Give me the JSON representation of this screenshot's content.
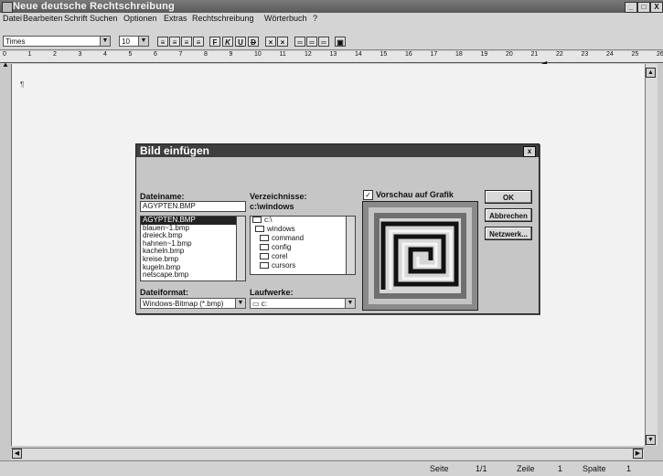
{
  "window": {
    "title": "Neue deutsche Rechtschreibung",
    "controls": [
      "_",
      "□",
      "X"
    ]
  },
  "menu": [
    "Datei",
    "Bearbeiten",
    "Schrift",
    "Suchen",
    "Optionen",
    "Extras",
    "Rechtschreibung",
    "Wörterbuch",
    "?"
  ],
  "toolbar": {
    "font_name": "Times",
    "font_size": "10",
    "format_buttons": [
      "F",
      "K",
      "U",
      "D"
    ]
  },
  "ruler": [
    "0",
    "1",
    "2",
    "3",
    "4",
    "5",
    "6",
    "7",
    "8",
    "9",
    "10",
    "11",
    "12",
    "13",
    "14",
    "15",
    "16",
    "17",
    "18",
    "19",
    "20",
    "21",
    "22",
    "23",
    "24",
    "25",
    "26"
  ],
  "dialog": {
    "title": "Bild einfügen",
    "close": "x",
    "filename_label": "Dateiname:",
    "filename_value": "AGYPTEN.BMP",
    "files": [
      "AGYPTEN.BMP",
      "blauen~1.bmp",
      "dreieck.bmp",
      "hahnen~1.bmp",
      "kacheln.bmp",
      "kreise.bmp",
      "kugeln.bmp",
      "netscape.bmp"
    ],
    "dir_label": "Verzeichnisse:",
    "dir_current": "c:\\windows",
    "dirs": [
      "c:\\",
      "windows",
      "command",
      "config",
      "corel",
      "cursors"
    ],
    "format_label": "Dateiformat:",
    "format_value": "Windows-Bitmap (*.bmp)",
    "drive_label": "Laufwerke:",
    "drive_value": "c:",
    "preview_label": "Vorschau auf Grafik",
    "preview_checked": "✓",
    "ok": "OK",
    "cancel": "Abbrechen",
    "network": "Netzwerk..."
  },
  "status": {
    "seite_label": "Seite",
    "seite_value": "1/1",
    "zeile_label": "Zeile",
    "zeile_value": "1",
    "spalte_label": "Spalte",
    "spalte_value": "1"
  }
}
